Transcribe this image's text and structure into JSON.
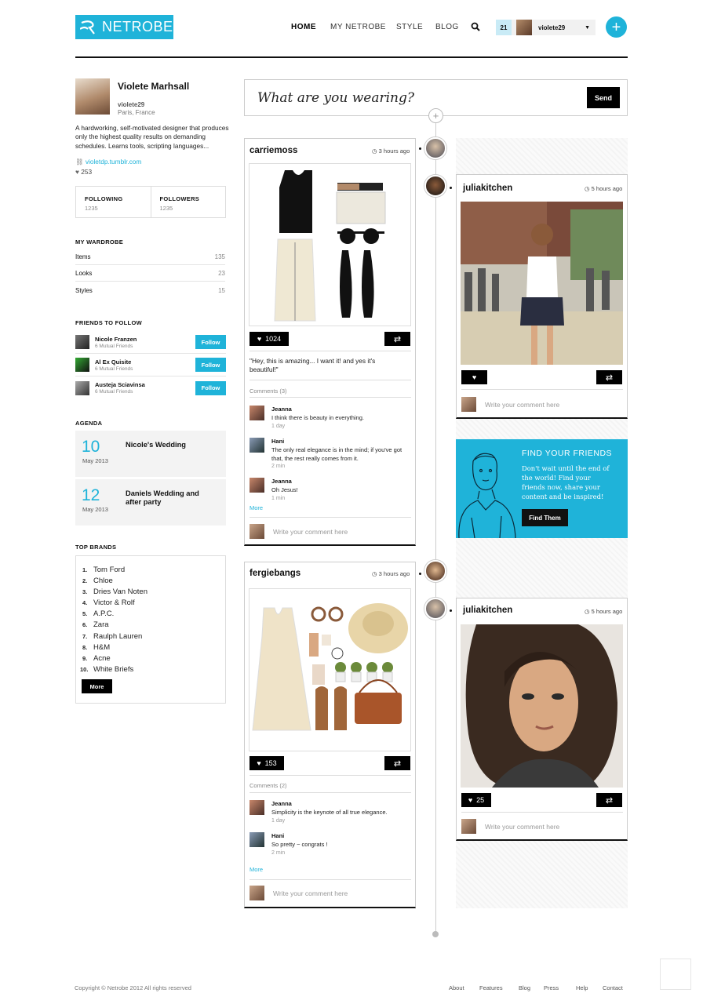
{
  "header": {
    "logo": "NETROBE",
    "nav": [
      "HOME",
      "MY NETROBE",
      "STYLE",
      "BLOG"
    ],
    "notifications": "21",
    "username": "violete29"
  },
  "profile": {
    "name": "Violete Marhsall",
    "username": "violete29",
    "location": "Paris, France",
    "bio": "A hardworking, self-motivated designer that produces only the highest quality results on demanding schedules. Learns tools, scripting languages...",
    "link": "violetdp.tumblr.com",
    "likes": "253",
    "following_label": "FOLLOWING",
    "following": "1235",
    "followers_label": "FOLLOWERS",
    "followers": "1235"
  },
  "wardrobe": {
    "title": "MY WARDROBE",
    "items": [
      {
        "label": "Items",
        "value": "135"
      },
      {
        "label": "Looks",
        "value": "23"
      },
      {
        "label": "Styles",
        "value": "15"
      }
    ]
  },
  "friends": {
    "title": "FRIENDS TO FOLLOW",
    "follow_label": "Follow",
    "items": [
      {
        "name": "Nicole Franzen",
        "mutual": "6 Mutual Friends"
      },
      {
        "name": "Al Ex Quisite",
        "mutual": "6 Mutual Friends"
      },
      {
        "name": "Austeja Sciavinsa",
        "mutual": "6 Mutual Friends"
      }
    ]
  },
  "agenda": {
    "title": "AGENDA",
    "items": [
      {
        "day": "10",
        "month": "May 2013",
        "event": "Nicole's Wedding"
      },
      {
        "day": "12",
        "month": "May 2013",
        "event": "Daniels Wedding and after party"
      }
    ]
  },
  "brands": {
    "title": "TOP BRANDS",
    "items": [
      "Tom Ford",
      "Chloe",
      "Dries Van Noten",
      "Victor & Rolf",
      "A.P.C.",
      "Zara",
      "Raulph Lauren",
      "H&M",
      "Acne",
      "White Briefs"
    ],
    "more": "More"
  },
  "composer": {
    "placeholder": "What are you wearing?",
    "send": "Send"
  },
  "posts": {
    "carrie": {
      "user": "carriemoss",
      "time": "3 hours ago",
      "likes": "1024",
      "quote": "\"Hey, this is amazing... I want it! and yes it's beautiful!\"",
      "comments_label": "Comments (3)",
      "comments": [
        {
          "name": "Jeanna",
          "text": "I think there is beauty in everything.",
          "time": "1 day"
        },
        {
          "name": "Hani",
          "text": "The only real elegance is in the mind; if you've got that, the rest really comes from it.",
          "time": "2 min"
        },
        {
          "name": "Jeanna",
          "text": "Oh Jesus!",
          "time": "1 min"
        }
      ],
      "more": "More",
      "write": "Write your comment here"
    },
    "julia1": {
      "user": "juliakitchen",
      "time": "5 hours ago",
      "write": "Write your comment here"
    },
    "fergie": {
      "user": "fergiebangs",
      "time": "3 hours ago",
      "likes": "153",
      "comments_label": "Comments (2)",
      "comments": [
        {
          "name": "Jeanna",
          "text": "Simplicity is the keynote of all true elegance.",
          "time": "1 day"
        },
        {
          "name": "Hani",
          "text": "So pretty ~ congrats !",
          "time": "2 min"
        }
      ],
      "more": "More",
      "write": "Write your comment here"
    },
    "julia2": {
      "user": "juliakitchen",
      "time": "5 hours ago",
      "likes": "25",
      "write": "Write your comment here"
    }
  },
  "ad": {
    "title": "FIND YOUR FRIENDS",
    "text": "Don't wait until the end of the world! Find your friends now, share your content and be inspired!",
    "button": "Find Them"
  },
  "footer": {
    "copyright": "Copyright © Netrobe 2012 All rights reserved",
    "links": [
      "About",
      "Features",
      "Blog",
      "Press",
      "Help",
      "Contact"
    ]
  }
}
